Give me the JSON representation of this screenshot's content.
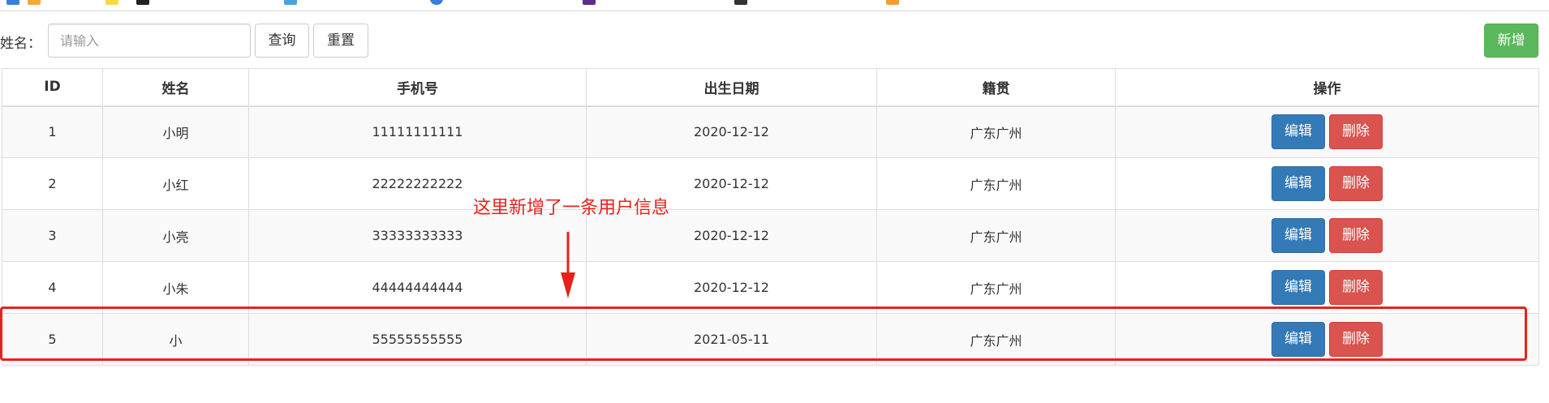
{
  "search": {
    "label": "姓名：",
    "placeholder": "请输入",
    "value": "",
    "query_label": "查询",
    "reset_label": "重置"
  },
  "toolbar": {
    "add_label": "新增"
  },
  "table": {
    "headers": [
      "ID",
      "姓名",
      "手机号",
      "出生日期",
      "籍贯",
      "操作"
    ],
    "rows": [
      {
        "id": "1",
        "name": "小明",
        "phone": "11111111111",
        "birth": "2020-12-12",
        "origin": "广东广州",
        "edit": "编辑",
        "delete": "删除"
      },
      {
        "id": "2",
        "name": "小红",
        "phone": "22222222222",
        "birth": "2020-12-12",
        "origin": "广东广州",
        "edit": "编辑",
        "delete": "删除"
      },
      {
        "id": "3",
        "name": "小亮",
        "phone": "33333333333",
        "birth": "2020-12-12",
        "origin": "广东广州",
        "edit": "编辑",
        "delete": "删除"
      },
      {
        "id": "4",
        "name": "小朱",
        "phone": "44444444444",
        "birth": "2020-12-12",
        "origin": "广东广州",
        "edit": "编辑",
        "delete": "删除"
      },
      {
        "id": "5",
        "name": "小",
        "phone": "55555555555",
        "birth": "2021-05-11",
        "origin": "广东广州",
        "edit": "编辑",
        "delete": "删除"
      }
    ]
  },
  "annotation": {
    "text": "这里新增了一条用户信息"
  },
  "colors": {
    "add_button": "#5cb85c",
    "edit_button": "#337ab7",
    "delete_button": "#d9534f",
    "annotation": "#e8211c"
  }
}
